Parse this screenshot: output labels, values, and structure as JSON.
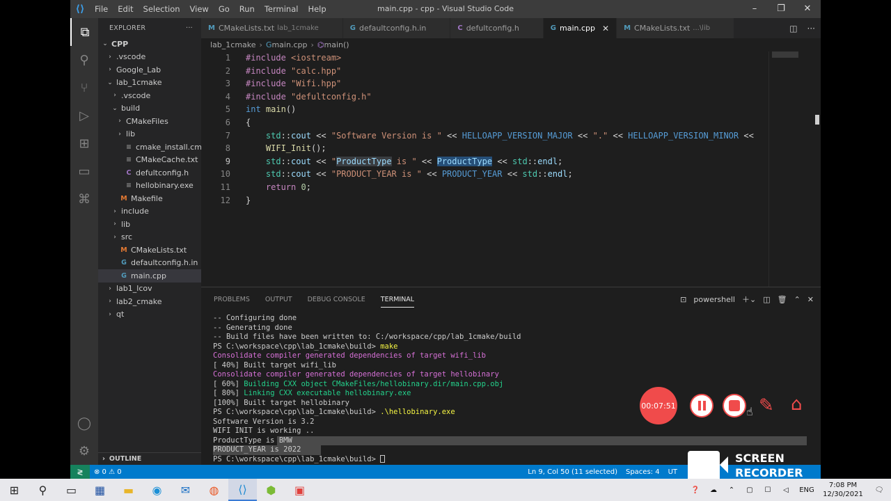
{
  "window": {
    "title": "main.cpp - cpp - Visual Studio Code",
    "menu": [
      "File",
      "Edit",
      "Selection",
      "View",
      "Go",
      "Run",
      "Terminal",
      "Help"
    ]
  },
  "sidebar": {
    "header": "EXPLORER",
    "outline_label": "OUTLINE",
    "items": [
      {
        "label": "CPP",
        "depth": 0,
        "chev": "⌄",
        "icon": "",
        "bold": true
      },
      {
        "label": ".vscode",
        "depth": 1,
        "chev": "›",
        "icon": ""
      },
      {
        "label": "Google_Lab",
        "depth": 1,
        "chev": "›",
        "icon": ""
      },
      {
        "label": "lab_1cmake",
        "depth": 1,
        "chev": "⌄",
        "icon": ""
      },
      {
        "label": ".vscode",
        "depth": 2,
        "chev": "›",
        "icon": ""
      },
      {
        "label": "build",
        "depth": 2,
        "chev": "⌄",
        "icon": ""
      },
      {
        "label": "CMakeFiles",
        "depth": 3,
        "chev": "›",
        "icon": ""
      },
      {
        "label": "lib",
        "depth": 3,
        "chev": "›",
        "icon": ""
      },
      {
        "label": "cmake_install.cmake",
        "depth": 3,
        "chev": "",
        "icon": "≡"
      },
      {
        "label": "CMakeCache.txt",
        "depth": 3,
        "chev": "",
        "icon": "≡"
      },
      {
        "label": "defultconfig.h",
        "depth": 3,
        "chev": "",
        "icon": "C"
      },
      {
        "label": "hellobinary.exe",
        "depth": 3,
        "chev": "",
        "icon": "≡"
      },
      {
        "label": "Makefile",
        "depth": 2,
        "chev": "",
        "icon": "M"
      },
      {
        "label": "include",
        "depth": 2,
        "chev": "›",
        "icon": ""
      },
      {
        "label": "lib",
        "depth": 2,
        "chev": "›",
        "icon": ""
      },
      {
        "label": "src",
        "depth": 2,
        "chev": "›",
        "icon": ""
      },
      {
        "label": "CMakeLists.txt",
        "depth": 2,
        "chev": "",
        "icon": "M"
      },
      {
        "label": "defaultconfig.h.in",
        "depth": 2,
        "chev": "",
        "icon": "G"
      },
      {
        "label": "main.cpp",
        "depth": 2,
        "chev": "",
        "icon": "G",
        "selected": true
      },
      {
        "label": "lab1_lcov",
        "depth": 1,
        "chev": "›",
        "icon": ""
      },
      {
        "label": "lab2_cmake",
        "depth": 1,
        "chev": "›",
        "icon": ""
      },
      {
        "label": "qt",
        "depth": 1,
        "chev": "›",
        "icon": ""
      }
    ]
  },
  "tabs": [
    {
      "icon": "M",
      "label": "CMakeLists.txt",
      "desc": "lab_1cmake",
      "color": "#519aba"
    },
    {
      "icon": "G",
      "label": "defaultconfig.h.in",
      "desc": "",
      "color": "#519aba"
    },
    {
      "icon": "C",
      "label": "defultconfig.h",
      "desc": "",
      "color": "#a074c4"
    },
    {
      "icon": "G",
      "label": "main.cpp",
      "desc": "",
      "color": "#519aba",
      "active": true
    },
    {
      "icon": "M",
      "label": "CMakeLists.txt",
      "desc": "...\\lib",
      "color": "#519aba"
    }
  ],
  "breadcrumb": [
    "lab_1cmake",
    "main.cpp",
    "main()"
  ],
  "code": [
    [
      [
        "pp",
        "#include "
      ],
      [
        "str",
        "<iostream>"
      ]
    ],
    [
      [
        "pp",
        "#include "
      ],
      [
        "str",
        "\"calc.hpp\""
      ]
    ],
    [
      [
        "pp",
        "#include "
      ],
      [
        "str",
        "\"Wifi.hpp\""
      ]
    ],
    [
      [
        "pp",
        "#include "
      ],
      [
        "str",
        "\"defultconfig.h\""
      ]
    ],
    [
      [
        "kw",
        "int "
      ],
      [
        "fn",
        "main"
      ],
      [
        "plain",
        "()"
      ]
    ],
    [
      [
        "plain",
        "{"
      ]
    ],
    [
      [
        "plain",
        "    "
      ],
      [
        "ns",
        "std"
      ],
      [
        "plain",
        "::"
      ],
      [
        "id",
        "cout"
      ],
      [
        "plain",
        " << "
      ],
      [
        "str",
        "\"Software Version is \""
      ],
      [
        "plain",
        " << "
      ],
      [
        "mac",
        "HELLOAPP_VERSION_MAJOR"
      ],
      [
        "plain",
        " << "
      ],
      [
        "str",
        "\".\""
      ],
      [
        "plain",
        " << "
      ],
      [
        "mac",
        "HELLOAPP_VERSION_MINOR"
      ],
      [
        "plain",
        " <<"
      ]
    ],
    [
      [
        "plain",
        "    "
      ],
      [
        "fn",
        "WIFI_Init"
      ],
      [
        "plain",
        "();"
      ]
    ],
    [
      [
        "plain",
        "    "
      ],
      [
        "ns",
        "std"
      ],
      [
        "plain",
        "::"
      ],
      [
        "id",
        "cout"
      ],
      [
        "plain",
        " << "
      ],
      [
        "str",
        "\""
      ],
      [
        "hl",
        "ProductType"
      ],
      [
        "str",
        " is \""
      ],
      [
        "plain",
        " << "
      ],
      [
        "hl2",
        "ProductType"
      ],
      [
        "plain",
        " << "
      ],
      [
        "ns",
        "std"
      ],
      [
        "plain",
        "::"
      ],
      [
        "id",
        "endl"
      ],
      [
        "plain",
        ";"
      ]
    ],
    [
      [
        "plain",
        "    "
      ],
      [
        "ns",
        "std"
      ],
      [
        "plain",
        "::"
      ],
      [
        "id",
        "cout"
      ],
      [
        "plain",
        " << "
      ],
      [
        "str",
        "\"PRODUCT_YEAR is \""
      ],
      [
        "plain",
        " << "
      ],
      [
        "mac",
        "PRODUCT_YEAR"
      ],
      [
        "plain",
        " << "
      ],
      [
        "ns",
        "std"
      ],
      [
        "plain",
        "::"
      ],
      [
        "id",
        "endl"
      ],
      [
        "plain",
        ";"
      ]
    ],
    [
      [
        "plain",
        "    "
      ],
      [
        "pp",
        "return "
      ],
      [
        "num",
        "0"
      ],
      [
        "plain",
        ";"
      ]
    ],
    [
      [
        "plain",
        "}"
      ]
    ]
  ],
  "panel": {
    "tabs": [
      "PROBLEMS",
      "OUTPUT",
      "DEBUG CONSOLE",
      "TERMINAL"
    ],
    "active_tab": "TERMINAL",
    "shell": "powershell",
    "terminal": [
      [
        [
          "",
          "-- Configuring done"
        ]
      ],
      [
        [
          "",
          "-- Generating done"
        ]
      ],
      [
        [
          "",
          "-- Build files have been written to: C:/workspace/cpp/lab_1cmake/build"
        ]
      ],
      [
        [
          "",
          "PS C:\\workspace\\cpp\\lab_1cmake\\build> "
        ],
        [
          "ty",
          "make"
        ]
      ],
      [
        [
          "tm",
          "Consolidate compiler generated dependencies of target wifi_lib"
        ]
      ],
      [
        [
          "",
          "[ 40%] Built target wifi_lib"
        ]
      ],
      [
        [
          "tm",
          "Consolidate compiler generated dependencies of target hellobinary"
        ]
      ],
      [
        [
          "",
          "[ 60%] "
        ],
        [
          "tg",
          "Building CXX object CMakeFiles/hellobinary.dir/main.cpp.obj"
        ]
      ],
      [
        [
          "",
          "[ 80%] "
        ],
        [
          "tg",
          "Linking CXX executable hellobinary.exe"
        ]
      ],
      [
        [
          "",
          "[100%] Built target hellobinary"
        ]
      ],
      [
        [
          "",
          "PS C:\\workspace\\cpp\\lab_1cmake\\build> "
        ],
        [
          "ty",
          ".\\hellobinary.exe"
        ]
      ],
      [
        [
          "",
          "Software Version is 3.2"
        ]
      ],
      [
        [
          "",
          "WIFI INIT is working .."
        ]
      ],
      [
        [
          "",
          "ProductType is BMW"
        ]
      ],
      [
        [
          "",
          "PRODUCT_YEAR is 2022"
        ]
      ],
      [
        [
          "",
          "PS C:\\workspace\\cpp\\lab_1cmake\\build> "
        ]
      ]
    ]
  },
  "recorder": {
    "timer": "00:07:51"
  },
  "statusbar": {
    "errors": "⊗ 0 ⚠ 0",
    "position": "Ln 9, Col 50 (11 selected)",
    "spaces": "Spaces: 4",
    "encoding": "UT"
  },
  "screen_recorder_logo": "SCREEN\nRECORDER",
  "taskbar": {
    "lang": "ENG",
    "time": "7:08 PM",
    "date": "12/30/2021"
  },
  "colors": {
    "accent": "#007acc",
    "titlebar": "#3c3c3c",
    "record": "#f04b4b"
  }
}
